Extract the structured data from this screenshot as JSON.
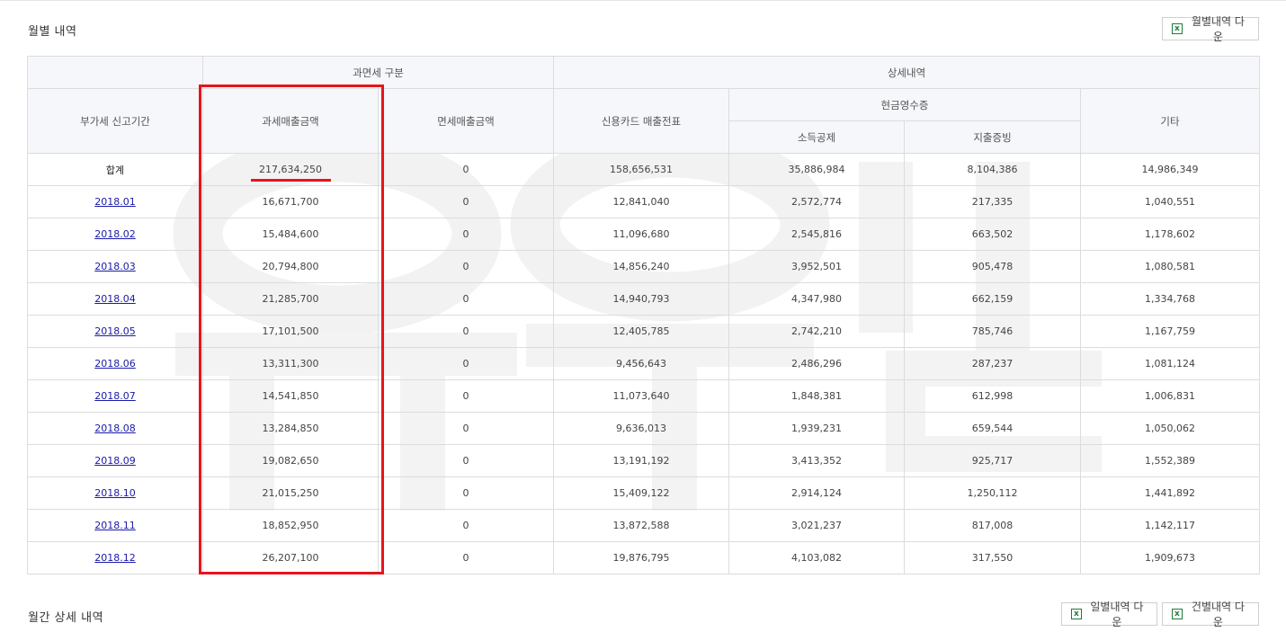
{
  "sections": {
    "monthly_title": "월별 내역",
    "detail_title": "월간 상세 내역"
  },
  "buttons": {
    "monthly_download": "월별내역 다운",
    "daily_download": "일별내역 다운",
    "each_download": "건별내역 다운"
  },
  "table": {
    "headers": {
      "period": "부가세 신고기간",
      "tax_group": "과면세 구분",
      "taxable": "과세매출금액",
      "exempt": "면세매출금액",
      "detail_group": "상세내역",
      "credit_card": "신용카드 매출전표",
      "cash_receipt": "현금영수증",
      "income_deduction": "소득공제",
      "expense_proof": "지출증빙",
      "other": "기타"
    },
    "rows": [
      {
        "period": "합계",
        "taxable": "217,634,250",
        "exempt": "0",
        "credit_card": "158,656,531",
        "income_deduction": "35,886,984",
        "expense_proof": "8,104,386",
        "other": "14,986,349"
      },
      {
        "period": "2018.01",
        "taxable": "16,671,700",
        "exempt": "0",
        "credit_card": "12,841,040",
        "income_deduction": "2,572,774",
        "expense_proof": "217,335",
        "other": "1,040,551"
      },
      {
        "period": "2018.02",
        "taxable": "15,484,600",
        "exempt": "0",
        "credit_card": "11,096,680",
        "income_deduction": "2,545,816",
        "expense_proof": "663,502",
        "other": "1,178,602"
      },
      {
        "period": "2018.03",
        "taxable": "20,794,800",
        "exempt": "0",
        "credit_card": "14,856,240",
        "income_deduction": "3,952,501",
        "expense_proof": "905,478",
        "other": "1,080,581"
      },
      {
        "period": "2018.04",
        "taxable": "21,285,700",
        "exempt": "0",
        "credit_card": "14,940,793",
        "income_deduction": "4,347,980",
        "expense_proof": "662,159",
        "other": "1,334,768"
      },
      {
        "period": "2018.05",
        "taxable": "17,101,500",
        "exempt": "0",
        "credit_card": "12,405,785",
        "income_deduction": "2,742,210",
        "expense_proof": "785,746",
        "other": "1,167,759"
      },
      {
        "period": "2018.06",
        "taxable": "13,311,300",
        "exempt": "0",
        "credit_card": "9,456,643",
        "income_deduction": "2,486,296",
        "expense_proof": "287,237",
        "other": "1,081,124"
      },
      {
        "period": "2018.07",
        "taxable": "14,541,850",
        "exempt": "0",
        "credit_card": "11,073,640",
        "income_deduction": "1,848,381",
        "expense_proof": "612,998",
        "other": "1,006,831"
      },
      {
        "period": "2018.08",
        "taxable": "13,284,850",
        "exempt": "0",
        "credit_card": "9,636,013",
        "income_deduction": "1,939,231",
        "expense_proof": "659,544",
        "other": "1,050,062"
      },
      {
        "period": "2018.09",
        "taxable": "19,082,650",
        "exempt": "0",
        "credit_card": "13,191,192",
        "income_deduction": "3,413,352",
        "expense_proof": "925,717",
        "other": "1,552,389"
      },
      {
        "period": "2018.10",
        "taxable": "21,015,250",
        "exempt": "0",
        "credit_card": "15,409,122",
        "income_deduction": "2,914,124",
        "expense_proof": "1,250,112",
        "other": "1,441,892"
      },
      {
        "period": "2018.11",
        "taxable": "18,852,950",
        "exempt": "0",
        "credit_card": "13,872,588",
        "income_deduction": "3,021,237",
        "expense_proof": "817,008",
        "other": "1,142,117"
      },
      {
        "period": "2018.12",
        "taxable": "26,207,100",
        "exempt": "0",
        "credit_card": "19,876,795",
        "income_deduction": "4,103,082",
        "expense_proof": "317,550",
        "other": "1,909,673"
      }
    ]
  },
  "colors": {
    "highlight": "#e8141c",
    "link": "#1a1aa8",
    "header_bg": "#f5f7fa",
    "excel_icon": "#1d7a3a"
  },
  "icons": {
    "download_button_icon": "excel-icon"
  }
}
